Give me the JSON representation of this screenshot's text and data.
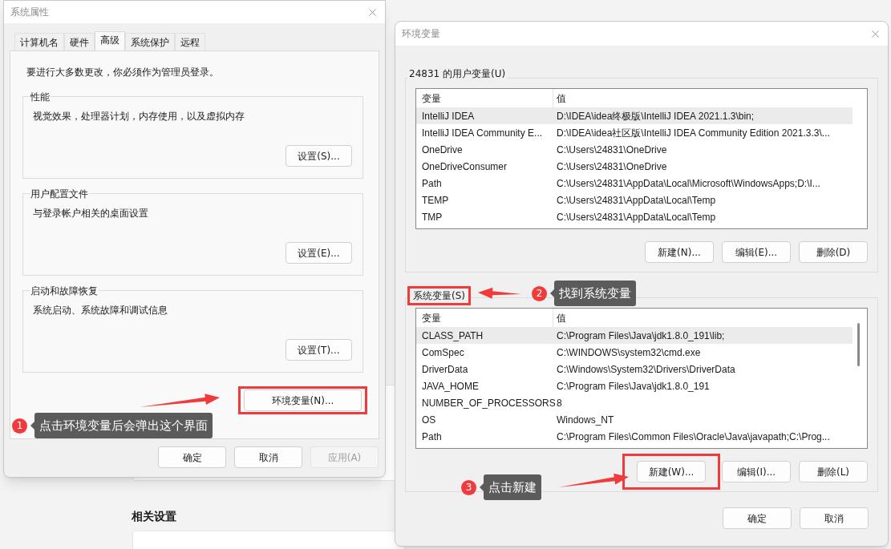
{
  "background": {
    "heading": "相关设置"
  },
  "system_properties": {
    "title": "系统属性",
    "tabs": [
      {
        "label": "计算机名",
        "selected": false
      },
      {
        "label": "硬件",
        "selected": false
      },
      {
        "label": "高级",
        "selected": true
      },
      {
        "label": "系统保护",
        "selected": false
      },
      {
        "label": "远程",
        "selected": false
      }
    ],
    "notice": "要进行大多数更改，你必须作为管理员登录。",
    "groups": [
      {
        "title": "性能",
        "description": "视觉效果，处理器计划，内存使用，以及虚拟内存",
        "button": "设置(S)..."
      },
      {
        "title": "用户配置文件",
        "description": "与登录帐户相关的桌面设置",
        "button": "设置(E)..."
      },
      {
        "title": "启动和故障恢复",
        "description": "系统启动、系统故障和调试信息",
        "button": "设置(T)..."
      }
    ],
    "env_button": {
      "label": "环境变量(N)...",
      "highlighted": true
    },
    "footer_buttons": [
      {
        "label": "确定",
        "disabled": false
      },
      {
        "label": "取消",
        "disabled": false
      },
      {
        "label": "应用(A)",
        "disabled": true
      }
    ]
  },
  "environment_variables": {
    "title": "环境变量",
    "sections": [
      {
        "title": "24831 的用户变量(U)",
        "highlighted": false,
        "scrollbar": false,
        "columns": [
          "变量",
          "值"
        ],
        "rows": [
          {
            "name": "IntelliJ IDEA",
            "value": "D:\\IDEA\\idea终极版\\IntelliJ IDEA 2021.1.3\\bin;",
            "selected": true
          },
          {
            "name": "IntelliJ IDEA Community E...",
            "value": "D:\\IDEA\\idea社区版\\IntelliJ IDEA Community Edition 2021.3.3\\...",
            "selected": false
          },
          {
            "name": "OneDrive",
            "value": "C:\\Users\\24831\\OneDrive",
            "selected": false
          },
          {
            "name": "OneDriveConsumer",
            "value": "C:\\Users\\24831\\OneDrive",
            "selected": false
          },
          {
            "name": "Path",
            "value": "C:\\Users\\24831\\AppData\\Local\\Microsoft\\WindowsApps;D:\\I...",
            "selected": false
          },
          {
            "name": "TEMP",
            "value": "C:\\Users\\24831\\AppData\\Local\\Temp",
            "selected": false
          },
          {
            "name": "TMP",
            "value": "C:\\Users\\24831\\AppData\\Local\\Temp",
            "selected": false
          }
        ],
        "buttons": [
          {
            "label": "新建(N)...",
            "highlighted": false
          },
          {
            "label": "编辑(E)...",
            "highlighted": false
          },
          {
            "label": "删除(D)",
            "highlighted": false
          }
        ]
      },
      {
        "title": "系统变量(S)",
        "highlighted": true,
        "scrollbar": true,
        "columns": [
          "变量",
          "值"
        ],
        "rows": [
          {
            "name": "CLASS_PATH",
            "value": "C:\\Program Files\\Java\\jdk1.8.0_191\\lib;",
            "selected": true
          },
          {
            "name": "ComSpec",
            "value": "C:\\WINDOWS\\system32\\cmd.exe",
            "selected": false
          },
          {
            "name": "DriverData",
            "value": "C:\\Windows\\System32\\Drivers\\DriverData",
            "selected": false
          },
          {
            "name": "JAVA_HOME",
            "value": "C:\\Program Files\\Java\\jdk1.8.0_191",
            "selected": false
          },
          {
            "name": "NUMBER_OF_PROCESSORS",
            "value": "8",
            "selected": false
          },
          {
            "name": "OS",
            "value": "Windows_NT",
            "selected": false
          },
          {
            "name": "Path",
            "value": "C:\\Program Files\\Common Files\\Oracle\\Java\\javapath;C:\\Prog...",
            "selected": false
          }
        ],
        "buttons": [
          {
            "label": "新建(W)...",
            "highlighted": true
          },
          {
            "label": "编辑(I)...",
            "highlighted": false
          },
          {
            "label": "删除(L)",
            "highlighted": false
          }
        ]
      }
    ],
    "footer_buttons": [
      {
        "label": "确定",
        "disabled": false
      },
      {
        "label": "取消",
        "disabled": false
      }
    ]
  },
  "annotations": [
    {
      "number": "1",
      "text": "点击环境变量后会弹出这个界面"
    },
    {
      "number": "2",
      "text": "找到系统变量"
    },
    {
      "number": "3",
      "text": "点击新建"
    }
  ]
}
